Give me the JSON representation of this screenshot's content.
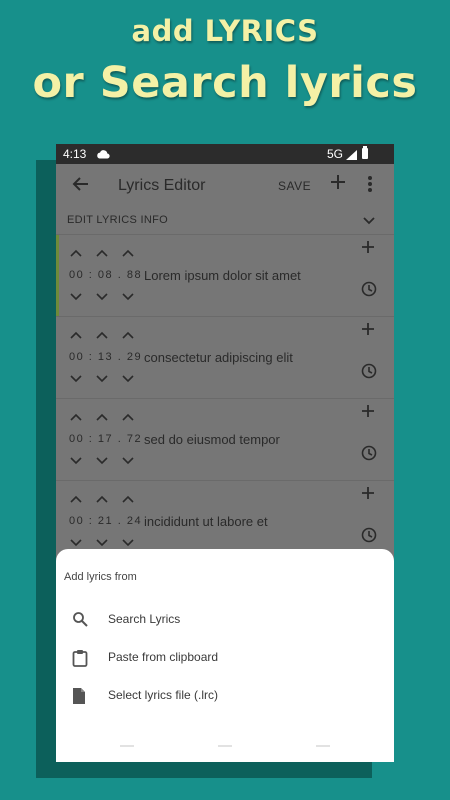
{
  "promo": {
    "line1": "add LYRICS",
    "line2": "or Search lyrics"
  },
  "status_bar": {
    "time": "4:13",
    "network": "5G"
  },
  "toolbar": {
    "title": "Lyrics Editor",
    "save_label": "SAVE"
  },
  "info_bar": {
    "label": "EDIT LYRICS INFO"
  },
  "lyrics": [
    {
      "min": "00",
      "sec": "08",
      "ms": "88",
      "text": "Lorem ipsum dolor sit amet"
    },
    {
      "min": "00",
      "sec": "13",
      "ms": "29",
      "text": "consectetur adipiscing elit"
    },
    {
      "min": "00",
      "sec": "17",
      "ms": "72",
      "text": "sed do eiusmod tempor"
    },
    {
      "min": "00",
      "sec": "21",
      "ms": "24",
      "text": "incididunt ut labore et"
    }
  ],
  "sheet": {
    "heading": "Add lyrics from",
    "items": [
      {
        "label": "Search Lyrics",
        "icon": "search-icon"
      },
      {
        "label": "Paste from clipboard",
        "icon": "clipboard-icon"
      },
      {
        "label": "Select lyrics file (.lrc)",
        "icon": "file-icon"
      }
    ]
  },
  "colors": {
    "background": "#17908b",
    "headline": "#f4f1a6",
    "dim_overlay": "#767676",
    "accent": "#6f8a3a"
  }
}
